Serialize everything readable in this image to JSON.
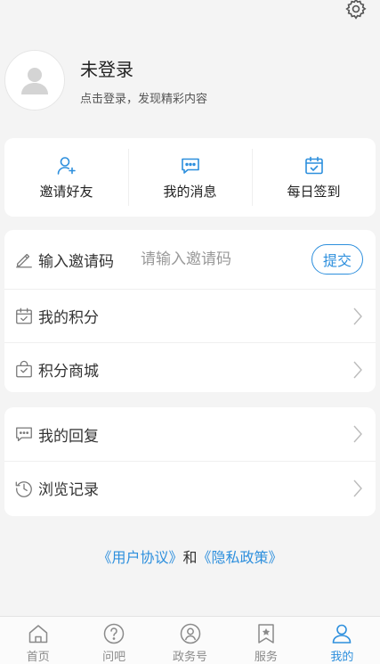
{
  "profile": {
    "name": "未登录",
    "subtitle": "点击登录，发现精彩内容"
  },
  "quick_actions": [
    {
      "label": "邀请好友",
      "icon": "add-user-icon"
    },
    {
      "label": "我的消息",
      "icon": "message-icon"
    },
    {
      "label": "每日签到",
      "icon": "calendar-check-icon"
    }
  ],
  "invite": {
    "label": "输入邀请码",
    "placeholder": "请输入邀请码",
    "submit_label": "提交",
    "icon": "pencil-icon"
  },
  "menu1": [
    {
      "label": "我的积分",
      "icon": "points-calendar-icon"
    },
    {
      "label": "积分商城",
      "icon": "shopping-bag-icon"
    }
  ],
  "menu2": [
    {
      "label": "我的回复",
      "icon": "reply-bubble-icon"
    },
    {
      "label": "浏览记录",
      "icon": "history-clock-icon"
    }
  ],
  "agreement": {
    "user_agreement": "《用户协议》",
    "and": "和",
    "privacy_policy": "《隐私政策》"
  },
  "tabs": [
    {
      "label": "首页",
      "icon": "home-icon",
      "active": false
    },
    {
      "label": "问吧",
      "icon": "question-icon",
      "active": false
    },
    {
      "label": "政务号",
      "icon": "government-badge-icon",
      "active": false
    },
    {
      "label": "服务",
      "icon": "bookmark-star-icon",
      "active": false
    },
    {
      "label": "我的",
      "icon": "person-icon",
      "active": true
    }
  ],
  "colors": {
    "accent": "#2d8fdd",
    "background": "#f4f4f4",
    "inactive_tab": "#8a8a8a"
  }
}
